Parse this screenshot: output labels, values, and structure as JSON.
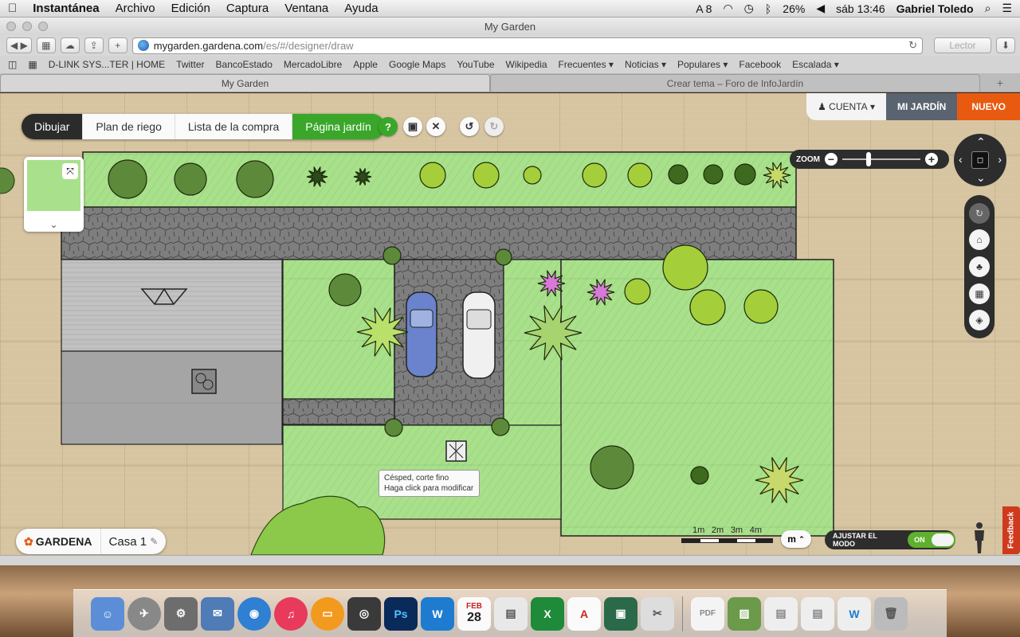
{
  "menubar": {
    "apple": "",
    "app_name": "Instantánea",
    "items": [
      "Archivo",
      "Edición",
      "Captura",
      "Ventana",
      "Ayuda"
    ],
    "status": {
      "notifications": "8",
      "battery": "26%",
      "clock": "sáb 13:46",
      "user": "Gabriel Toledo"
    }
  },
  "window": {
    "title": "My Garden"
  },
  "browser": {
    "url_host": "mygarden.gardena.com",
    "url_path": "/es/#/designer/draw",
    "reader_label": "Lector",
    "bookmarks": [
      "D-LINK SYS...TER | HOME",
      "Twitter",
      "BancoEstado",
      "MercadoLibre",
      "Apple",
      "Google Maps",
      "YouTube",
      "Wikipedia",
      "Frecuentes ▾",
      "Noticias ▾",
      "Populares ▾",
      "Facebook",
      "Escalada ▾"
    ],
    "tabs": [
      {
        "label": "My Garden"
      },
      {
        "label": "Crear tema – Foro de InfoJardín"
      }
    ]
  },
  "app": {
    "tabs": [
      "Dibujar",
      "Plan de riego",
      "Lista de la compra",
      "Página jardín"
    ],
    "help_label": "?",
    "account": {
      "user_label": "CUENTA",
      "my_garden_label": "MI JARDÍN",
      "new_label": "NUEVO"
    },
    "zoom_label": "ZOOM",
    "zoom_minus": "−",
    "zoom_plus": "+",
    "tooltip": {
      "line1": "Césped, corte fino",
      "line2": "Haga click para modificar"
    },
    "brand": {
      "logo": "GARDENA",
      "project_name": "Casa 1"
    },
    "scale_labels": [
      "1m",
      "2m",
      "3m",
      "4m"
    ],
    "unit_label": "m",
    "mode": {
      "label": "AJUSTAR EL MODO",
      "state": "ON"
    },
    "feedback_label": "Feedback"
  },
  "colors": {
    "accent_green": "#3aa72a",
    "new_orange": "#e85a10",
    "lawn": "#a9e08c",
    "paving": "#8e8e8e"
  },
  "dock": {
    "calendar_day": "28",
    "calendar_month": "FEB"
  }
}
